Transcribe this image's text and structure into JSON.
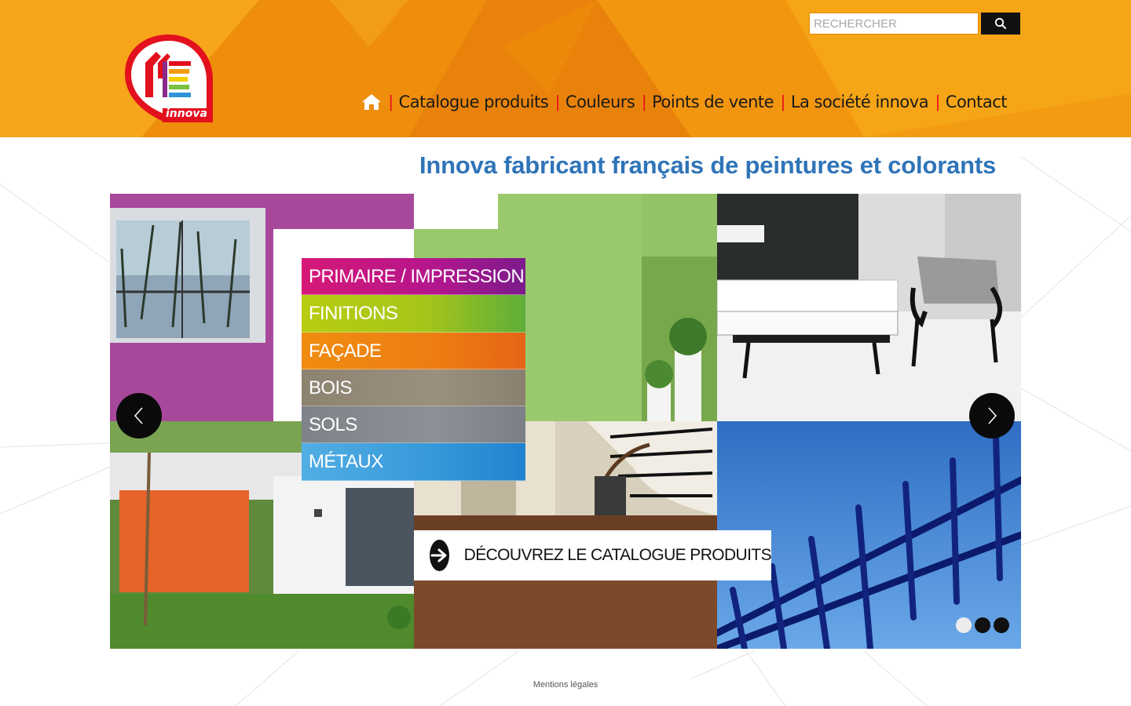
{
  "header": {
    "brand": "innova",
    "search": {
      "placeholder": "RECHERCHER"
    },
    "nav": {
      "items": [
        {
          "label": "Catalogue produits"
        },
        {
          "label": "Couleurs"
        },
        {
          "label": "Points de vente"
        },
        {
          "label": "La société innova"
        },
        {
          "label": "Contact"
        }
      ],
      "separator": "|"
    }
  },
  "main": {
    "tagline": "Innova fabricant français de peintures et colorants",
    "slider": {
      "categories": [
        {
          "label": "PRIMAIRE / IMPRESSION",
          "color": "#c4168a"
        },
        {
          "label": "FINITIONS",
          "color": "#a8c51a"
        },
        {
          "label": "FAÇADE",
          "color": "#ef8210"
        },
        {
          "label": "BOIS",
          "color": "#8e8576"
        },
        {
          "label": "SOLS",
          "color": "#83888c"
        },
        {
          "label": "MÉTAUX",
          "color": "#2f95d8"
        }
      ],
      "cta_label": "DÉCOUVREZ LE CATALOGUE PRODUITS",
      "slide_count": 3,
      "active_slide": 1
    }
  },
  "footer": {
    "legal_link": "Mentions légales"
  },
  "colors": {
    "header_orange": "#f39c12",
    "tagline_blue": "#2f74b8",
    "accent_red": "#e8141b"
  }
}
